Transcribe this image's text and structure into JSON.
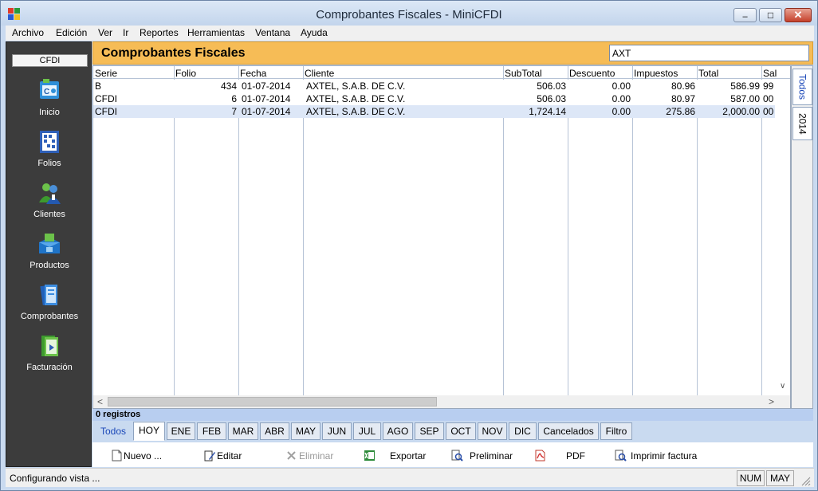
{
  "window": {
    "title": "Comprobantes Fiscales - MiniCFDI",
    "minimize_glyph": "–",
    "maximize_glyph": "□",
    "close_glyph": "✕"
  },
  "menu": [
    "Archivo",
    "Edición",
    "Ver",
    "Ir",
    "Reportes",
    "Herramientas",
    "Ventana",
    "Ayuda"
  ],
  "sidebar": {
    "tab_label": "CFDI",
    "items": [
      {
        "label": "Inicio",
        "icon": "home-icon"
      },
      {
        "label": "Folios",
        "icon": "folios-icon"
      },
      {
        "label": "Clientes",
        "icon": "clients-icon"
      },
      {
        "label": "Productos",
        "icon": "products-icon"
      },
      {
        "label": "Comprobantes",
        "icon": "receipts-icon"
      },
      {
        "label": "Facturación",
        "icon": "billing-icon"
      }
    ]
  },
  "header": {
    "title": "Comprobantes Fiscales",
    "search_value": "AXT"
  },
  "grid": {
    "columns": [
      "Serie",
      "Folio",
      "Fecha",
      "Cliente",
      "SubTotal",
      "Descuento",
      "Impuestos",
      "Total",
      "Sal"
    ],
    "rows": [
      [
        "B",
        "434",
        "01-07-2014",
        "AXTEL, S.A.B. DE C.V.",
        "506.03",
        "0.00",
        "80.96",
        "586.99",
        "99"
      ],
      [
        "CFDI",
        "6",
        "01-07-2014",
        "AXTEL, S.A.B. DE C.V.",
        "506.03",
        "0.00",
        "80.97",
        "587.00",
        "00"
      ],
      [
        "CFDI",
        "7",
        "01-07-2014",
        "AXTEL, S.A.B. DE C.V.",
        "1,724.14",
        "0.00",
        "275.86",
        "2,000.00",
        "00"
      ]
    ],
    "scroll_left": "<",
    "scroll_right": ">",
    "scroll_down": "∨"
  },
  "side_tabs": [
    "Todos",
    "2014"
  ],
  "record_count": "0 registros",
  "filter_tabs": [
    "Todos",
    "HOY",
    "ENE",
    "FEB",
    "MAR",
    "ABR",
    "MAY",
    "JUN",
    "JUL",
    "AGO",
    "SEP",
    "OCT",
    "NOV",
    "DIC",
    "Cancelados",
    "Filtro"
  ],
  "selected_filter_tab": "HOY",
  "actions": [
    {
      "label": "Nuevo ...",
      "icon": "new-document-icon",
      "enabled": true
    },
    {
      "label": "Editar",
      "icon": "edit-icon",
      "enabled": true
    },
    {
      "label": "Eliminar",
      "icon": "delete-icon",
      "enabled": false
    },
    {
      "label": "Exportar",
      "icon": "excel-export-icon",
      "enabled": true
    },
    {
      "label": "Preliminar",
      "icon": "preview-icon",
      "enabled": true
    },
    {
      "label": "PDF",
      "icon": "pdf-icon",
      "enabled": true
    },
    {
      "label": "Imprimir factura",
      "icon": "print-invoice-icon",
      "enabled": true
    }
  ],
  "statusbar": {
    "message": "Configurando vista ...",
    "indicators": [
      "NUM",
      "MAY"
    ]
  },
  "colors": {
    "header": "#f6bc56",
    "sidebar": "#3c3c3c",
    "frame": "#c9daf0",
    "status_strip": "#b8cef0"
  }
}
